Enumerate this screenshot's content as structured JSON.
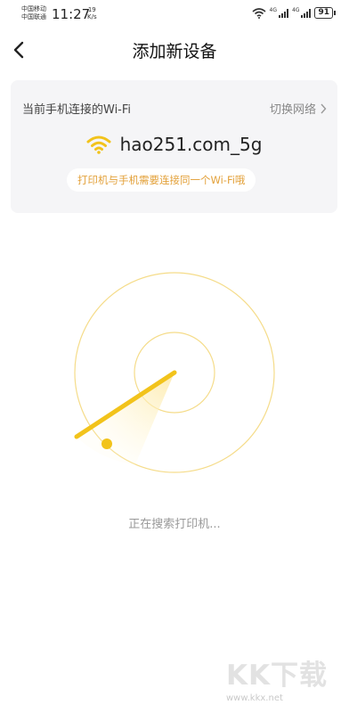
{
  "status_bar": {
    "carrier_1": "中国移动",
    "carrier_2": "中国联通",
    "time": "11:27",
    "speed_value": "19",
    "speed_unit": "K/s",
    "network_1": "4G",
    "network_2": "4G",
    "battery": "91",
    "icons": [
      "wifi-icon",
      "signal-icon",
      "battery-icon"
    ]
  },
  "header": {
    "title": "添加新设备",
    "back_icon": "chevron-left-icon"
  },
  "wifi_card": {
    "label": "当前手机连接的Wi-Fi",
    "switch_label": "切换网络",
    "ssid": "hao251.com_5g",
    "tip": "打印机与手机需要连接同一个Wi-Fi哦",
    "accent_color": "#f2c31b",
    "tip_color": "#e3a13a"
  },
  "search": {
    "status": "正在搜索打印机..."
  },
  "watermark": {
    "logo": "KK下载",
    "url": "www.kkx.net"
  }
}
